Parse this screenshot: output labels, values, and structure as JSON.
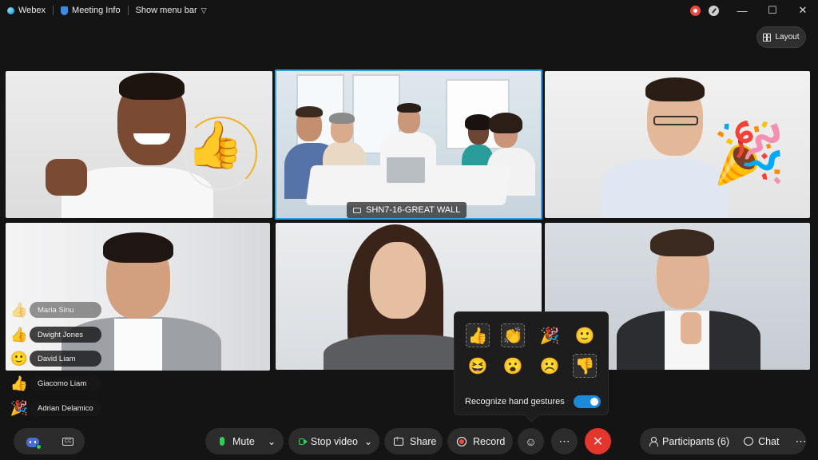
{
  "titlebar": {
    "app_name": "Webex",
    "meeting_info": "Meeting Info",
    "show_menu_bar": "Show menu bar",
    "minimize": "—",
    "maximize": "☐",
    "close": "✕"
  },
  "layout_button": "Layout",
  "video_tiles": [
    {
      "reaction": "👍"
    },
    {
      "room_label": "SHN7-16-GREAT WALL"
    },
    {
      "reaction": "🎉"
    },
    {},
    {},
    {}
  ],
  "participants_reactions": [
    {
      "emoji": "👍",
      "name": "Maria Sinu"
    },
    {
      "emoji": "👍",
      "name": "Dwight Jones"
    },
    {
      "emoji": "🙂",
      "name": "David Liam"
    },
    {
      "emoji": "👍",
      "name": "Giacomo Liam"
    },
    {
      "emoji": "🎉",
      "name": "Adrian Delamico"
    }
  ],
  "reactions_popup": {
    "row1": [
      "👍",
      "👏",
      "🎉",
      "🙂"
    ],
    "row2": [
      "😆",
      "😮",
      "☹️",
      "👎"
    ],
    "gesture_label": "Recognize hand gestures",
    "gesture_enabled": true
  },
  "controls": {
    "mute": "Mute",
    "stop_video": "Stop video",
    "share": "Share",
    "record": "Record",
    "reactions_icon": "☺",
    "more_icon": "⋯",
    "end_icon": "✕",
    "participants": "Participants (6)",
    "chat": "Chat",
    "overflow_icon": "⋯",
    "dropdown_icon": "⌄",
    "cc_label": "CC"
  },
  "colors": {
    "accent": "#1c8ad8",
    "active_speaker_border": "#2aa3e0",
    "mic_green": "#2fd15e",
    "end_red": "#e3362c"
  }
}
